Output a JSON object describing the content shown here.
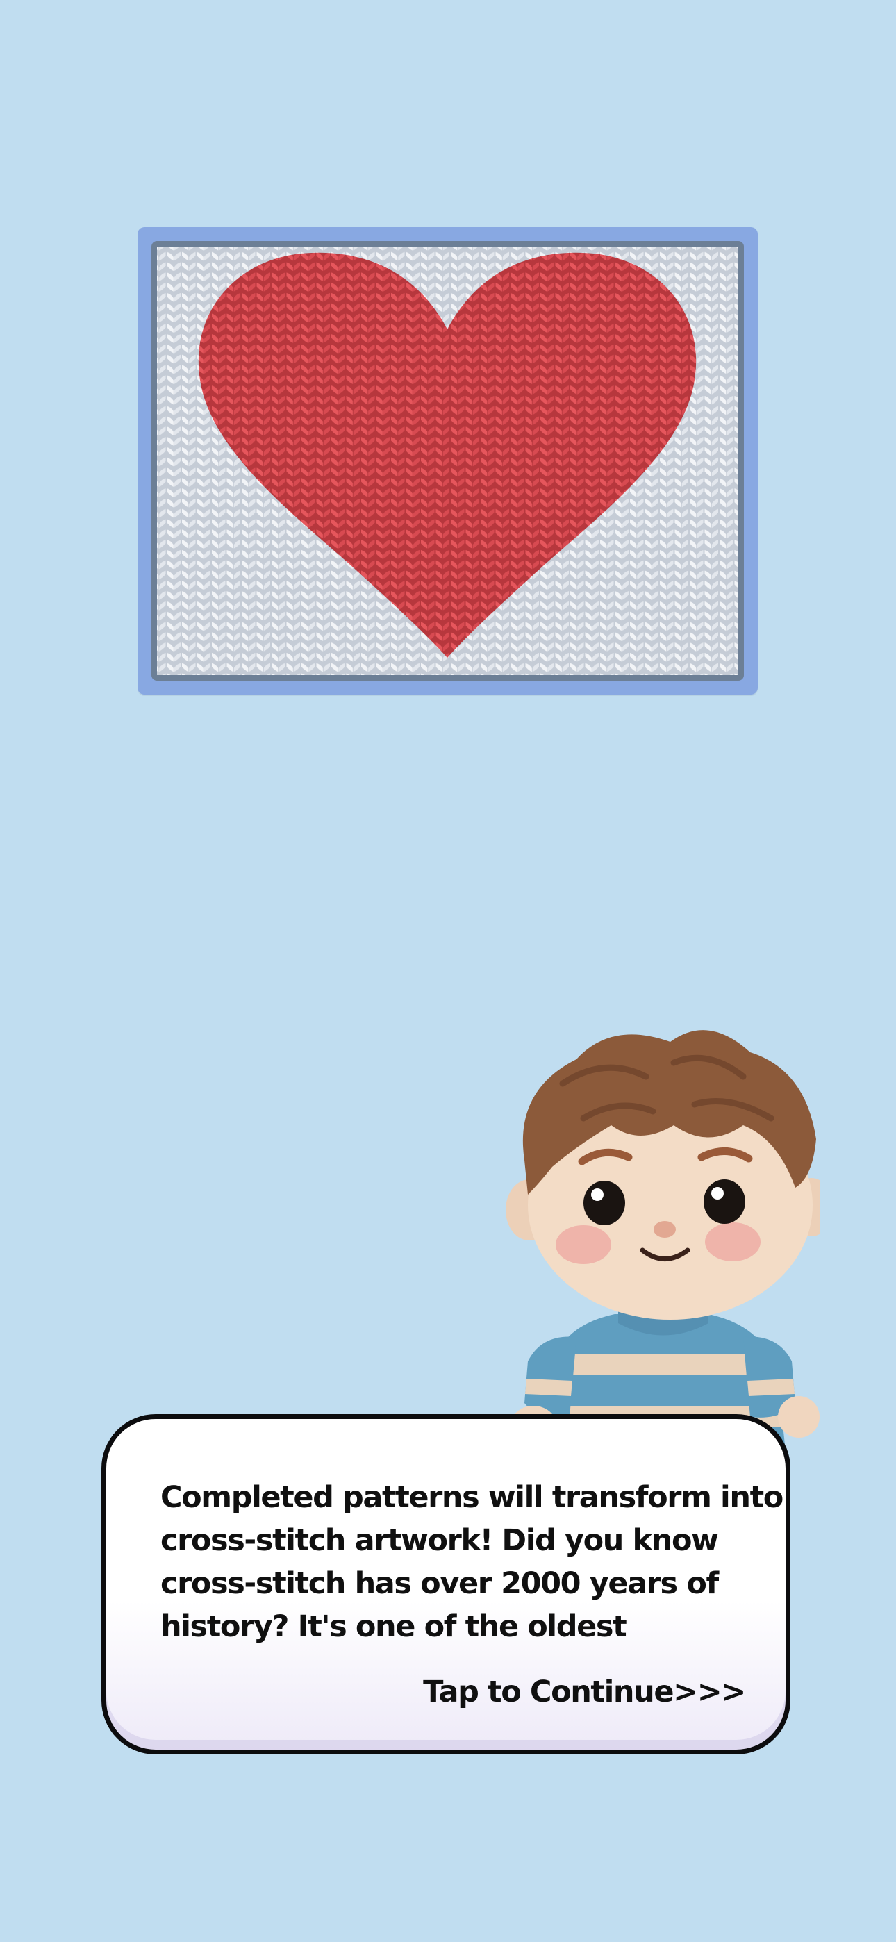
{
  "colors": {
    "background": "#c0ddf0",
    "frame_outer": "#88a8e2",
    "frame_inner": "#6c7f96",
    "stitch_white": "#e9ecf1",
    "stitch_red": "#df4e55",
    "dialog_border": "#0c0c0e"
  },
  "artwork": {
    "subject": "heart-icon"
  },
  "dialog": {
    "lines": [
      "Completed patterns will transform into",
      "cross-stitch artwork! Did you know",
      "cross-stitch has over 2000 years of",
      "history? It's one of the oldest"
    ],
    "continue_label": "Tap to Continue>>>"
  }
}
